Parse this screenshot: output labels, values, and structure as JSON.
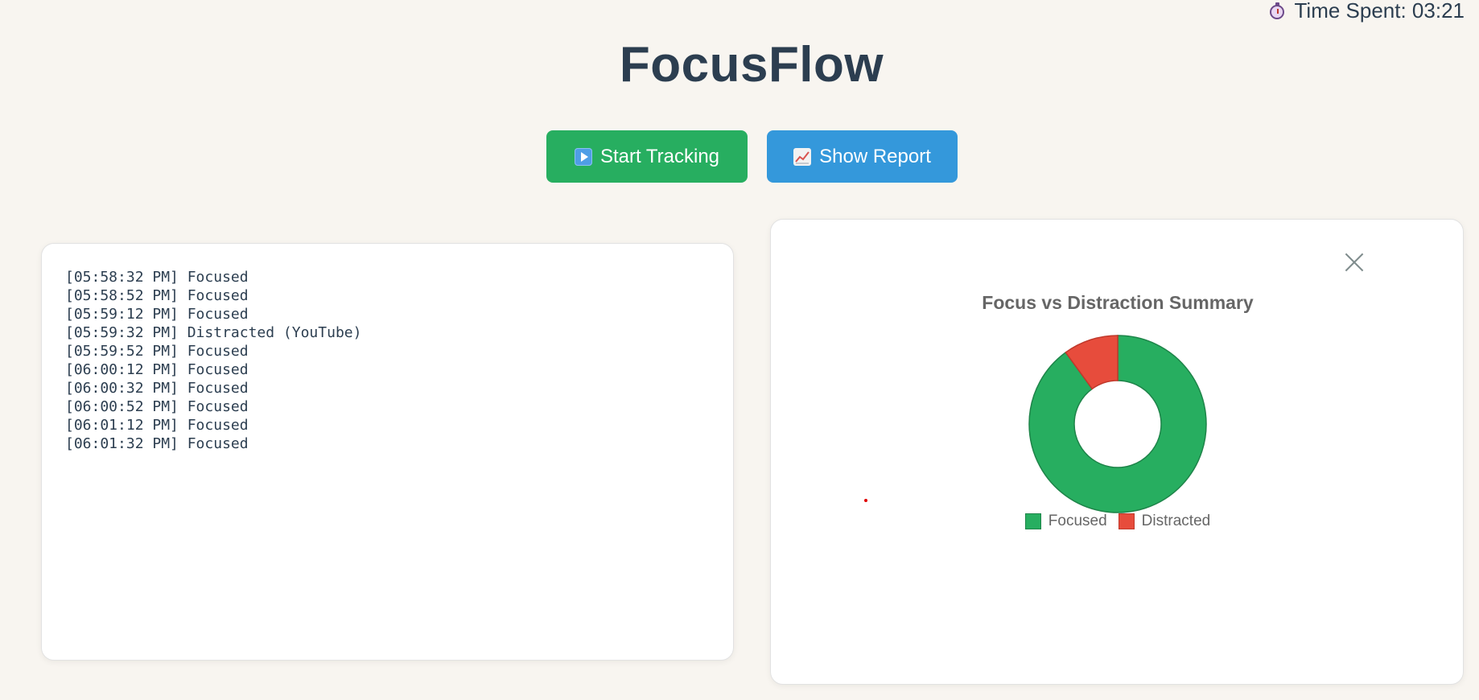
{
  "timer": {
    "icon": "stopwatch-icon",
    "text": "Time Spent: 03:21"
  },
  "app": {
    "title": "FocusFlow"
  },
  "toolbar": {
    "start_label": "Start Tracking",
    "start_icon": "play-button-icon",
    "report_label": "Show Report",
    "report_icon": "chart-increasing-icon"
  },
  "log": {
    "lines": [
      "[05:58:32 PM] Focused",
      "[05:58:52 PM] Focused",
      "[05:59:12 PM] Focused",
      "[05:59:32 PM] Distracted (YouTube)",
      "[05:59:52 PM] Focused",
      "[06:00:12 PM] Focused",
      "[06:00:32 PM] Focused",
      "[06:00:52 PM] Focused",
      "[06:01:12 PM] Focused",
      "[06:01:32 PM] Focused"
    ]
  },
  "report": {
    "close_icon": "close-icon"
  },
  "colors": {
    "background": "#f8f5f0",
    "focused": "#27ae60",
    "distracted": "#e74c3c",
    "start_button": "#27ae60",
    "report_button": "#3498db",
    "title": "#2c3e50"
  },
  "chart_data": {
    "type": "pie",
    "variant": "doughnut",
    "title": "Focus vs Distraction Summary",
    "categories": [
      "Focused",
      "Distracted"
    ],
    "values": [
      9,
      1
    ],
    "colors": [
      "#27ae60",
      "#e74c3c"
    ],
    "legend": "bottom"
  }
}
